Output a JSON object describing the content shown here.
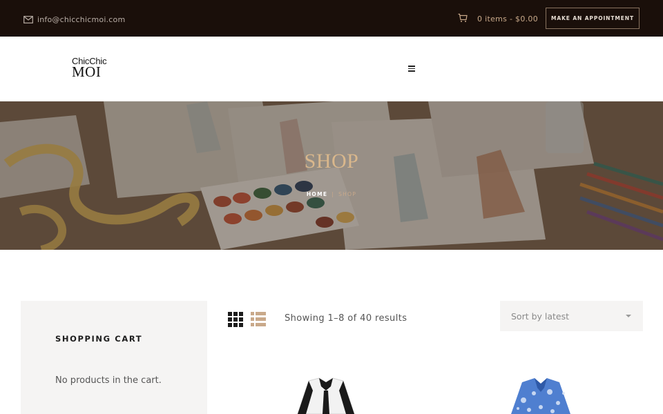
{
  "topbar": {
    "email": "info@chicchicmoi.com",
    "email_icon": "envelope-icon",
    "cart_icon": "shopping-cart-icon",
    "cart_summary": "0 items - $0.00",
    "appointment_button": "MAKE AN APPOINTMENT"
  },
  "header": {
    "logo_line1": "ChicChic",
    "logo_line2": "MOI",
    "menu_icon": "hamburger-menu-icon"
  },
  "hero": {
    "title": "SHOP",
    "breadcrumb_home": "HOME",
    "breadcrumb_separator": "|",
    "breadcrumb_current": "SHOP",
    "title_color": "#d9b78c"
  },
  "sidebar": {
    "heading": "SHOPPING CART",
    "empty_text": "No products in the cart."
  },
  "shop": {
    "grid_view_icon": "grid-view-icon",
    "list_view_icon": "list-view-icon",
    "results_text": "Showing 1–8 of 40 results",
    "sort_label": "Sort by latest",
    "sort_icon": "chevron-down-icon"
  },
  "products": [
    {
      "image": "black-white-jacket-image"
    },
    {
      "image": "blue-floral-jacket-image"
    }
  ],
  "colors": {
    "topbar_bg": "#1a0f0a",
    "accent": "#c9a98a",
    "panel_bg": "#f5f4f3"
  }
}
